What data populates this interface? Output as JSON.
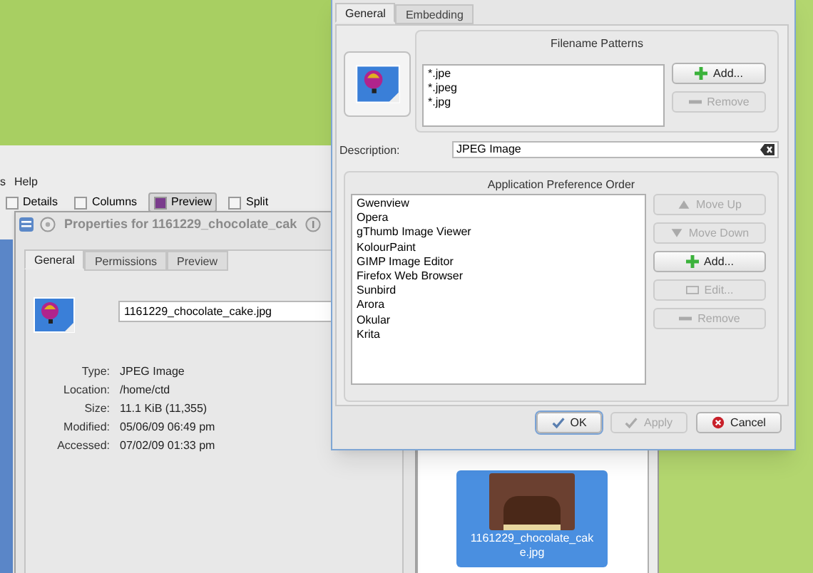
{
  "file_manager": {
    "menu": [
      "s",
      "Help"
    ],
    "toolbar": [
      {
        "label": "Details",
        "selected": false
      },
      {
        "label": "Columns",
        "selected": false
      },
      {
        "label": "Preview",
        "selected": true
      },
      {
        "label": "Split",
        "selected": false
      }
    ],
    "files": [
      {
        "name": "1161229_chocolate_cake.jpg",
        "selected": true
      }
    ]
  },
  "properties_dialog": {
    "title": "Properties for 1161229_chocolate_cak",
    "tabs": [
      {
        "label": "General",
        "selected": true
      },
      {
        "label": "Permissions",
        "selected": false
      },
      {
        "label": "Preview",
        "selected": false
      }
    ],
    "filename": "1161229_chocolate_cake.jpg",
    "fields": [
      {
        "label": "Type:",
        "value": "JPEG Image"
      },
      {
        "label": "Location:",
        "value": "/home/ctd"
      },
      {
        "label": "Size:",
        "value": "11.1 KiB (11,355)"
      },
      {
        "label": "Modified:",
        "value": "05/06/09 06:49 pm"
      },
      {
        "label": "Accessed:",
        "value": "07/02/09 01:33 pm"
      }
    ]
  },
  "filetype_dialog": {
    "tabs": [
      {
        "label": "General",
        "selected": true
      },
      {
        "label": "Embedding",
        "selected": false
      }
    ],
    "filename_patterns": {
      "title": "Filename Patterns",
      "patterns": [
        "*.jpe",
        "*.jpeg",
        "*.jpg"
      ],
      "buttons": [
        {
          "label": "Add...",
          "kind": "add",
          "disabled": false
        },
        {
          "label": "Remove",
          "kind": "remove",
          "disabled": true
        }
      ]
    },
    "description": {
      "label": "Description:",
      "value": "JPEG Image"
    },
    "app_order": {
      "title": "Application Preference Order",
      "apps": [
        "Gwenview",
        "Opera",
        "gThumb Image Viewer",
        "KolourPaint",
        "GIMP Image Editor",
        "Firefox Web Browser",
        "Sunbird",
        "Arora",
        "Okular",
        "Krita"
      ],
      "buttons": [
        {
          "label": "Move Up",
          "kind": "up",
          "disabled": true
        },
        {
          "label": "Move Down",
          "kind": "down",
          "disabled": true
        },
        {
          "label": "Add...",
          "kind": "add",
          "disabled": false
        },
        {
          "label": "Edit...",
          "kind": "edit",
          "disabled": true
        },
        {
          "label": "Remove",
          "kind": "remove",
          "disabled": true
        }
      ]
    },
    "footer_buttons": [
      {
        "label": "OK",
        "kind": "ok",
        "disabled": false
      },
      {
        "label": "Apply",
        "kind": "apply",
        "disabled": true
      },
      {
        "label": "Cancel",
        "kind": "cancel",
        "disabled": false
      }
    ]
  }
}
